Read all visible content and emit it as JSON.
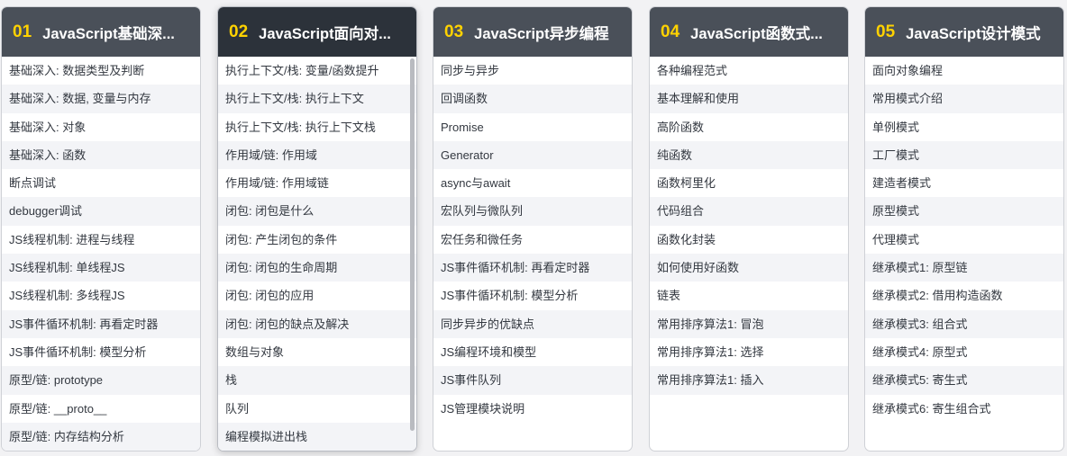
{
  "cards": [
    {
      "num": "01",
      "title": "JavaScript基础深...",
      "items": [
        "基础深入: 数据类型及判断",
        "基础深入: 数据, 变量与内存",
        "基础深入: 对象",
        "基础深入: 函数",
        "断点调试",
        "debugger调试",
        "JS线程机制: 进程与线程",
        "JS线程机制: 单线程JS",
        "JS线程机制: 多线程JS",
        "JS事件循环机制: 再看定时器",
        "JS事件循环机制: 模型分析",
        "原型/链: prototype",
        "原型/链: __proto__",
        "原型/链: 内存结构分析"
      ]
    },
    {
      "num": "02",
      "title": "JavaScript面向对...",
      "items": [
        "执行上下文/栈: 变量/函数提升",
        "执行上下文/栈: 执行上下文",
        "执行上下文/栈: 执行上下文栈",
        "作用域/链: 作用域",
        "作用域/链: 作用域链",
        "闭包: 闭包是什么",
        "闭包: 产生闭包的条件",
        "闭包: 闭包的生命周期",
        "闭包: 闭包的应用",
        "闭包: 闭包的缺点及解决",
        "数组与对象",
        "栈",
        "队列",
        "编程模拟进出栈"
      ]
    },
    {
      "num": "03",
      "title": "JavaScript异步编程",
      "items": [
        "同步与异步",
        "回调函数",
        "Promise",
        "Generator",
        "async与await",
        "宏队列与微队列",
        "宏任务和微任务",
        "JS事件循环机制: 再看定时器",
        "JS事件循环机制: 模型分析",
        "同步异步的优缺点",
        "JS编程环境和模型",
        "JS事件队列",
        "JS管理模块说明"
      ]
    },
    {
      "num": "04",
      "title": "JavaScript函数式...",
      "items": [
        "各种编程范式",
        "基本理解和使用",
        "高阶函数",
        "纯函数",
        "函数柯里化",
        "代码组合",
        "函数化封装",
        "如何使用好函数",
        "链表",
        "常用排序算法1: 冒泡",
        "常用排序算法1: 选择",
        "常用排序算法1: 插入"
      ]
    },
    {
      "num": "05",
      "title": "JavaScript设计模式",
      "items": [
        "面向对象编程",
        "常用模式介绍",
        "单例模式",
        "工厂模式",
        "建造者模式",
        "原型模式",
        "代理模式",
        "继承模式1: 原型链",
        "继承模式2: 借用构造函数",
        "继承模式3: 组合式",
        "继承模式4: 原型式",
        "继承模式5: 寄生式",
        "继承模式6: 寄生组合式"
      ]
    }
  ],
  "colors": {
    "header_bg": "#4a5059",
    "header_bg_active": "#2c323a",
    "number_color": "#ffd200",
    "title_color": "#ffffff",
    "row_alt_bg": "#f3f4f7",
    "page_bg": "#f2f2f4"
  }
}
